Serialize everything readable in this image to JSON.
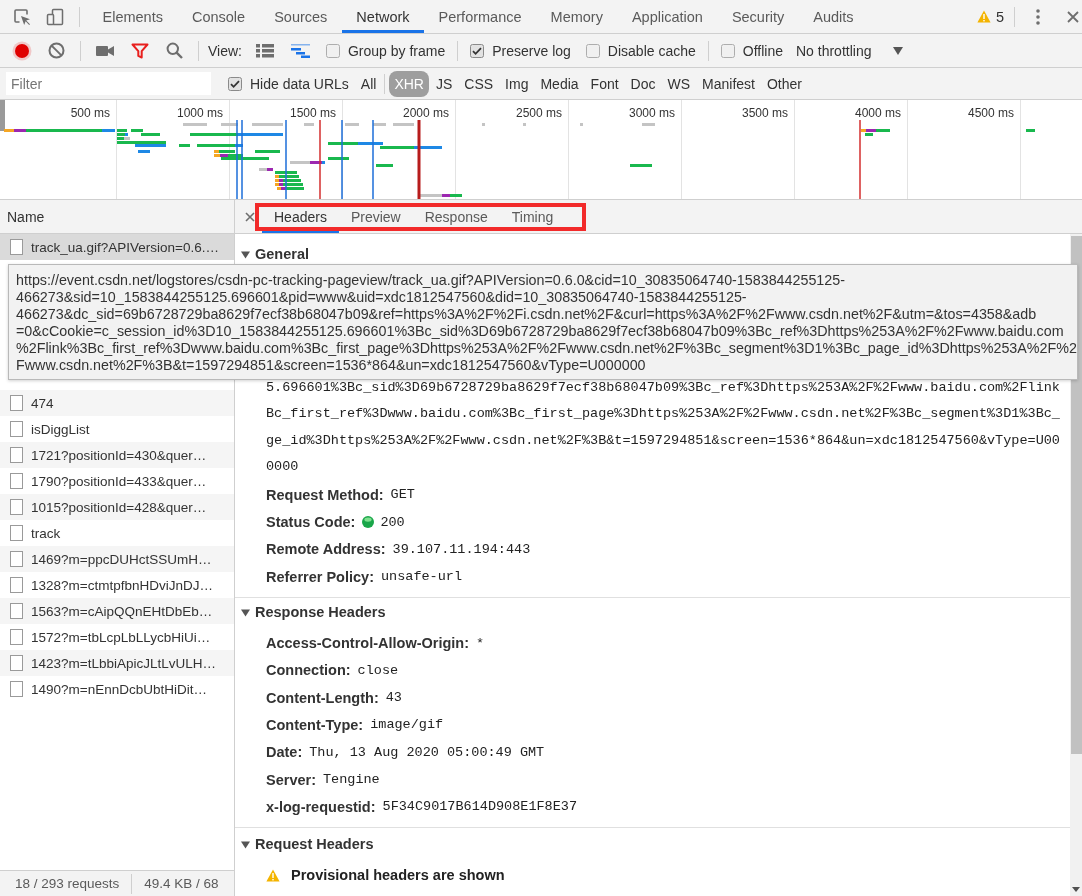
{
  "main_tabs": [
    {
      "label": "Elements",
      "selected": false
    },
    {
      "label": "Console",
      "selected": false
    },
    {
      "label": "Sources",
      "selected": false
    },
    {
      "label": "Network",
      "selected": true
    },
    {
      "label": "Performance",
      "selected": false
    },
    {
      "label": "Memory",
      "selected": false
    },
    {
      "label": "Application",
      "selected": false
    },
    {
      "label": "Security",
      "selected": false
    },
    {
      "label": "Audits",
      "selected": false
    }
  ],
  "warning_count": "5",
  "toolbar": {
    "recording": true,
    "filter_shown": true,
    "view_label": "View:",
    "large_rows": false,
    "overview": true,
    "options": [
      {
        "label": "Group by frame",
        "checked": false
      },
      {
        "label": "Preserve log",
        "checked": true
      },
      {
        "label": "Disable cache",
        "checked": false
      },
      {
        "label": "Offline",
        "checked": false
      }
    ],
    "throttling": "No throttling"
  },
  "filter_bar": {
    "placeholder": "Filter",
    "hide_data_urls": {
      "label": "Hide data URLs",
      "checked": true
    },
    "types": [
      {
        "label": "All",
        "selected": false
      },
      {
        "label": "XHR",
        "selected": true
      },
      {
        "label": "JS",
        "selected": false
      },
      {
        "label": "CSS",
        "selected": false
      },
      {
        "label": "Img",
        "selected": false
      },
      {
        "label": "Media",
        "selected": false
      },
      {
        "label": "Font",
        "selected": false
      },
      {
        "label": "Doc",
        "selected": false
      },
      {
        "label": "WS",
        "selected": false
      },
      {
        "label": "Manifest",
        "selected": false
      },
      {
        "label": "Other",
        "selected": false
      }
    ]
  },
  "overview": {
    "ticks": [
      "500 ms",
      "1000 ms",
      "1500 ms",
      "2000 ms",
      "2500 ms",
      "3000 ms",
      "3500 ms",
      "4000 ms",
      "4500 ms"
    ]
  },
  "requests": {
    "column": "Name",
    "rows": [
      {
        "name": "track_ua.gif?APIVersion=0.6.…",
        "selected": true
      },
      {
        "name": "474",
        "selected": false
      },
      {
        "name": "isDiggList",
        "selected": false
      },
      {
        "name": "1721?positionId=430&quer…",
        "selected": false
      },
      {
        "name": "1790?positionId=433&quer…",
        "selected": false
      },
      {
        "name": "1015?positionId=428&quer…",
        "selected": false
      },
      {
        "name": "track",
        "selected": false
      },
      {
        "name": "1469?m=ppcDUHctSSUmH…",
        "selected": false
      },
      {
        "name": "1328?m=ctmtpfbnHDviJnDJ…",
        "selected": false
      },
      {
        "name": "1563?m=cAipQQnEHtDbEb…",
        "selected": false
      },
      {
        "name": "1572?m=tbLcpLbLLycbHiUi…",
        "selected": false
      },
      {
        "name": "1423?m=tLbbiApicJLtLvULH…",
        "selected": false
      },
      {
        "name": "1490?m=nEnnDcbUbtHiDit…",
        "selected": false
      }
    ],
    "summary": [
      "18 / 293 requests",
      "49.4 KB / 68"
    ]
  },
  "details": {
    "tabs": [
      {
        "label": "Headers",
        "selected": true
      },
      {
        "label": "Preview",
        "selected": false
      },
      {
        "label": "Response",
        "selected": false
      },
      {
        "label": "Timing",
        "selected": false
      }
    ],
    "highlighted": true,
    "sections": [
      {
        "title": "General",
        "expanded": true,
        "url_lines": [
          "5.696601%3Bc_sid%3D69b6728729ba8629f7ecf38b68047b09%3Bc_ref%3Dhttps%253A%2F%2Fwww.baidu.com%2Flink",
          "Bc_first_ref%3Dwww.baidu.com%3Bc_first_page%3Dhttps%253A%2F%2Fwww.csdn.net%2F%3Bc_segment%3D1%3Bc_",
          "ge_id%3Dhttps%253A%2F%2Fwww.csdn.net%2F%3B&t=1597294851&screen=1536*864&un=xdc1812547560&vType=U00",
          "0000"
        ],
        "fields": [
          {
            "kind": "text",
            "name": "Request Method:",
            "value": "GET"
          },
          {
            "kind": "status",
            "name": "Status Code:",
            "value": "200"
          },
          {
            "kind": "text",
            "name": "Remote Address:",
            "value": "39.107.11.194:443"
          },
          {
            "kind": "text",
            "name": "Referrer Policy:",
            "value": "unsafe-url"
          }
        ]
      },
      {
        "title": "Response Headers",
        "expanded": true,
        "fields": [
          {
            "kind": "text",
            "name": "Access-Control-Allow-Origin:",
            "value": "*"
          },
          {
            "kind": "text",
            "name": "Connection:",
            "value": "close"
          },
          {
            "kind": "text",
            "name": "Content-Length:",
            "value": "43"
          },
          {
            "kind": "text",
            "name": "Content-Type:",
            "value": "image/gif"
          },
          {
            "kind": "text",
            "name": "Date:",
            "value": "Thu, 13 Aug 2020 05:00:49 GMT"
          },
          {
            "kind": "text",
            "name": "Server:",
            "value": "Tengine"
          },
          {
            "kind": "text",
            "name": "x-log-requestid:",
            "value": "5F34C9017B614D908E1F8E37"
          }
        ]
      },
      {
        "title": "Request Headers",
        "expanded": true,
        "notice": "Provisional headers are shown"
      }
    ]
  },
  "tooltip": {
    "lines": [
      "https://event.csdn.net/logstores/csdn-pc-tracking-pageview/track_ua.gif?APIVersion=0.6.0&cid=10_30835064740-1583844255125-",
      "466273&sid=10_1583844255125.696601&pid=www&uid=xdc1812547560&did=10_30835064740-1583844255125-",
      "466273&dc_sid=69b6728729ba8629f7ecf38b68047b09&ref=https%3A%2F%2Fi.csdn.net%2F&curl=https%3A%2F%2Fwww.csdn.net%2F&utm=&tos=4358&adb",
      "=0&cCookie=c_session_id%3D10_1583844255125.696601%3Bc_sid%3D69b6728729ba8629f7ecf38b68047b09%3Bc_ref%3Dhttps%253A%2F%2Fwww.baidu.com",
      "%2Flink%3Bc_first_ref%3Dwww.baidu.com%3Bc_first_page%3Dhttps%253A%2F%2Fwww.csdn.net%2F%3Bc_segment%3D1%3Bc_page_id%3Dhttps%253A%2F%2",
      "Fwww.csdn.net%2F%3B&t=1597294851&screen=1536*864&un=xdc1812547560&vType=U000000"
    ]
  }
}
